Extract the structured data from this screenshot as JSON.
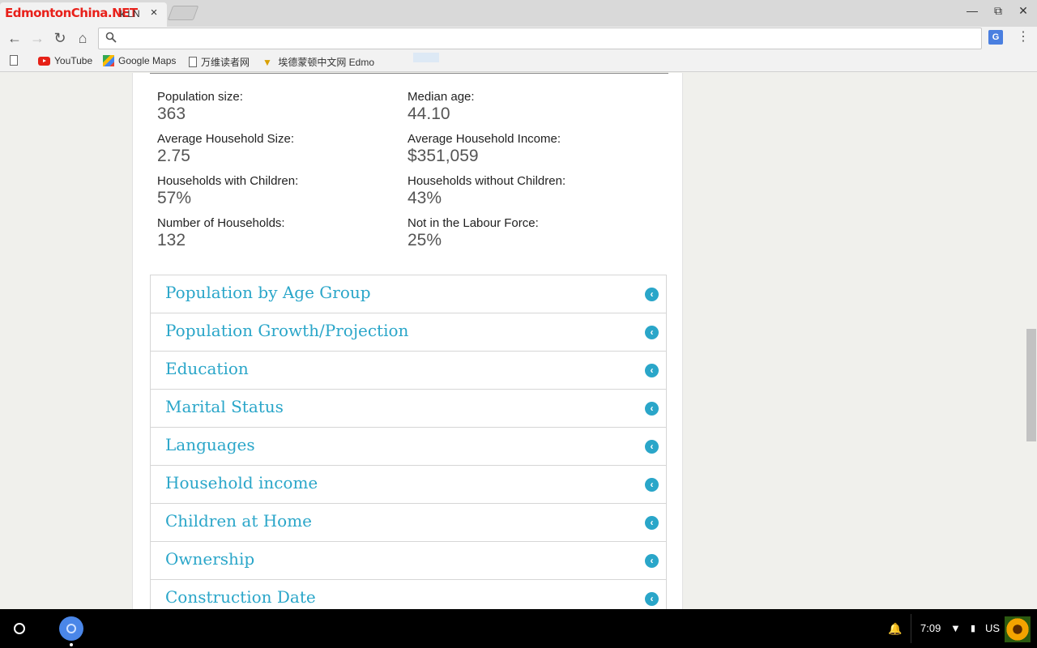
{
  "browser": {
    "tab": {
      "site_label": "EdmontonChina.NET",
      "title": "k LN N",
      "close_label": "×"
    },
    "window_controls": {
      "minimize": "—",
      "restore": "⧉",
      "close": "✕"
    },
    "omnibox": {
      "value": "",
      "placeholder": ""
    },
    "bookmarks": [
      {
        "label": "",
        "icon": "page-icon"
      },
      {
        "label": "YouTube",
        "icon": "youtube-icon"
      },
      {
        "label": "Google Maps",
        "icon": "maps-icon"
      },
      {
        "label": "万维读者网",
        "icon": "page-icon"
      },
      {
        "label": "埃德蒙顿中文网 Edmo",
        "icon": "trophy-icon"
      }
    ]
  },
  "stats": [
    {
      "label": "Population size:",
      "value": "363"
    },
    {
      "label": "Median age:",
      "value": "44.10"
    },
    {
      "label": "Average Household Size:",
      "value": "2.75"
    },
    {
      "label": "Average Household Income:",
      "value": "$351,059"
    },
    {
      "label": "Households with Children:",
      "value": "57%"
    },
    {
      "label": "Households without Children:",
      "value": "43%"
    },
    {
      "label": "Number of Households:",
      "value": "132"
    },
    {
      "label": "Not in the Labour Force:",
      "value": "25%"
    }
  ],
  "sections": [
    "Population by Age Group",
    "Population Growth/Projection",
    "Education",
    "Marital Status",
    "Languages",
    "Household income",
    "Children at Home",
    "Ownership",
    "Construction Date"
  ],
  "accent_color": "#2aa6c9",
  "shelf": {
    "time": "7:09",
    "keyboard": "US"
  }
}
